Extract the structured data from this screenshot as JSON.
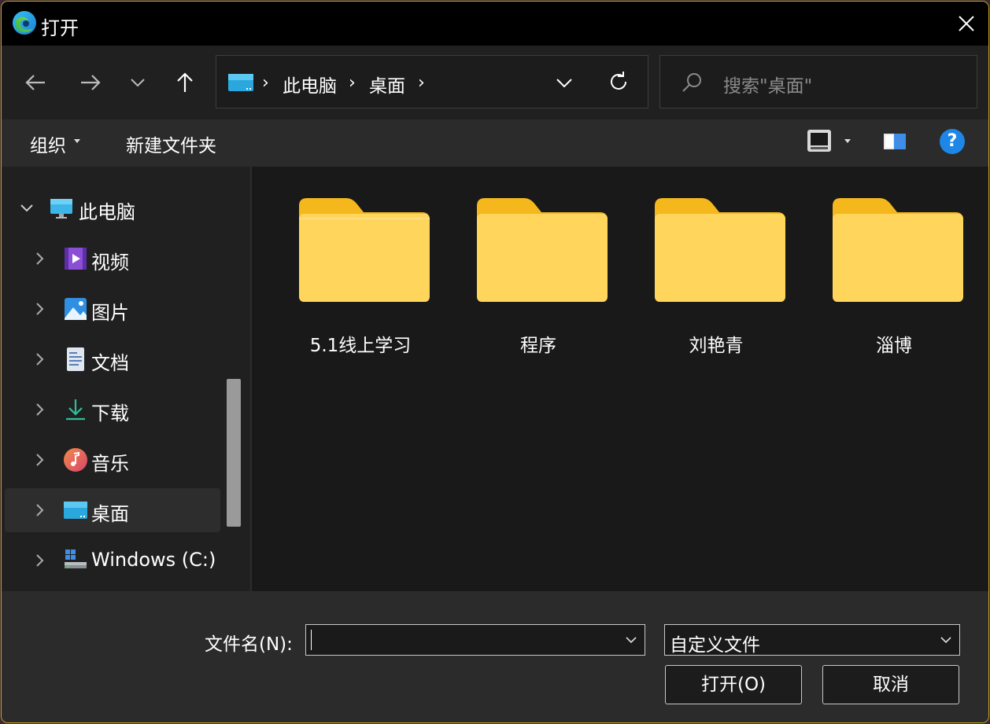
{
  "window": {
    "title": "打开"
  },
  "address": {
    "crumbs": [
      "此电脑",
      "桌面"
    ]
  },
  "search": {
    "placeholder": "搜索\"桌面\""
  },
  "toolbar": {
    "organize_label": "组织",
    "new_folder_label": "新建文件夹",
    "help_label": "?"
  },
  "sidebar": {
    "items": [
      {
        "label": "此电脑",
        "icon": "monitor-icon",
        "expanded": true
      },
      {
        "label": "视频",
        "icon": "video-icon"
      },
      {
        "label": "图片",
        "icon": "picture-icon"
      },
      {
        "label": "文档",
        "icon": "document-icon"
      },
      {
        "label": "下载",
        "icon": "download-icon"
      },
      {
        "label": "音乐",
        "icon": "music-icon"
      },
      {
        "label": "桌面",
        "icon": "desktop-icon",
        "selected": true
      },
      {
        "label": "Windows (C:)",
        "icon": "drive-icon"
      }
    ]
  },
  "content": {
    "folders": [
      {
        "name": "5.1线上学习"
      },
      {
        "name": "程序"
      },
      {
        "name": "刘艳青"
      },
      {
        "name": "淄博"
      }
    ]
  },
  "footer": {
    "filename_label": "文件名(N):",
    "filename_value": "",
    "filetype_value": "自定义文件",
    "open_label": "打开(O)",
    "cancel_label": "取消"
  },
  "colors": {
    "titlebar": "#000000",
    "panel": "#2b2b2b",
    "folder_front": "#ffd55c",
    "folder_back": "#f5b81c",
    "accent": "#1e86e6"
  }
}
